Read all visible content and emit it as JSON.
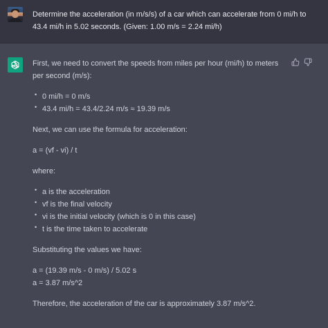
{
  "user": {
    "question": "Determine the acceleration (in m/s/s) of a car which can accelerate from 0 mi/h to 43.4 mi/h in 5.02 seconds. (Given: 1.00 m/s = 2.24 mi/h)"
  },
  "assistant": {
    "intro": "First, we need to convert the speeds from miles per hour (mi/h) to meters per second (m/s):",
    "conversions": [
      "0 mi/h = 0 m/s",
      "43.4 mi/h = 43.4/2.24 m/s ≈ 19.39 m/s"
    ],
    "formula_intro": "Next, we can use the formula for acceleration:",
    "formula": "a = (vf - vi) / t",
    "where_label": "where:",
    "definitions": [
      "a is the acceleration",
      "vf is the final velocity",
      "vi is the initial velocity (which is 0 in this case)",
      "t is the time taken to accelerate"
    ],
    "substitute_intro": "Substituting the values we have:",
    "calc_line1": "a = (19.39 m/s - 0 m/s) / 5.02 s",
    "calc_line2": "a = 3.87 m/s^2",
    "conclusion": "Therefore, the acceleration of the car is approximately 3.87 m/s^2."
  },
  "icons": {
    "user_avatar": "user-avatar",
    "assistant_logo": "openai-logo-icon",
    "thumbs_up": "thumbs-up-icon",
    "thumbs_down": "thumbs-down-icon"
  },
  "colors": {
    "user_bg": "#343541",
    "assistant_bg": "#444654",
    "logo_bg": "#10a37f",
    "text": "#d1d5db"
  }
}
